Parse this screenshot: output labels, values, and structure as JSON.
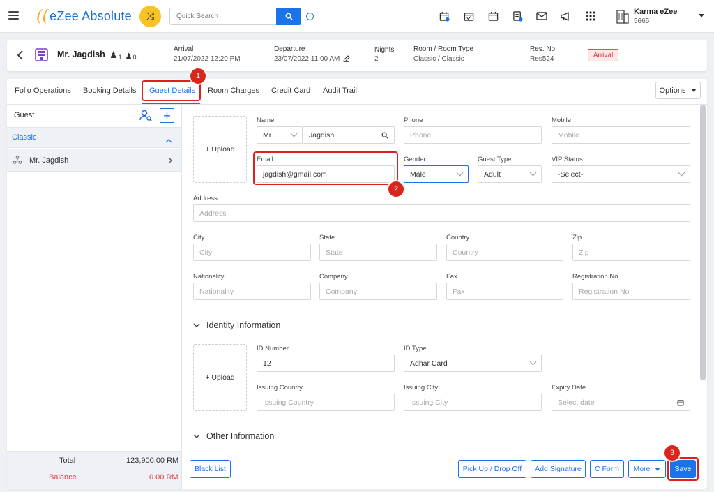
{
  "app": {
    "logo_glyph": "((",
    "brand": "eZee Absolute"
  },
  "search": {
    "placeholder": "Quick Search"
  },
  "user": {
    "name": "Karma eZee",
    "code": "5665"
  },
  "reservation": {
    "guest_name": "Mr. Jagdish",
    "adults": "1",
    "children": "0",
    "arrival_label": "Arrival",
    "arrival_value": "21/07/2022 12:20 PM",
    "departure_label": "Departure",
    "departure_value": "23/07/2022 11:00 AM",
    "nights_label": "Nights",
    "nights_value": "2",
    "room_label": "Room / Room Type",
    "room_value": "Classic / Classic",
    "resno_label": "Res. No.",
    "resno_value": "Res524",
    "status": "Arrival"
  },
  "tabs": [
    "Folio Operations",
    "Booking Details",
    "Guest Details",
    "Room Charges",
    "Credit Card",
    "Audit Trail"
  ],
  "options_label": "Options",
  "left": {
    "guest_label": "Guest",
    "group": "Classic",
    "guest_item": "Mr. Jagdish",
    "total_label": "Total",
    "total_value": "123,900.00 RM",
    "balance_label": "Balance",
    "balance_value": "0.00 RM"
  },
  "form": {
    "upload": "+ Upload",
    "name_label": "Name",
    "salutation": "Mr.",
    "name_value": "Jagdish",
    "phone_label": "Phone",
    "phone_ph": "Phone",
    "mobile_label": "Mobile",
    "mobile_ph": "Mobile",
    "email_label": "Email",
    "email_value": "jagdish@gmail.com",
    "gender_label": "Gender",
    "gender_value": "Male",
    "gtype_label": "Guest Type",
    "gtype_value": "Adult",
    "vip_label": "VIP Status",
    "vip_value": "-Select-",
    "address_label": "Address",
    "address_ph": "Address",
    "city_label": "City",
    "city_ph": "City",
    "state_label": "State",
    "state_ph": "State",
    "country_label": "Country",
    "country_ph": "Country",
    "zip_label": "Zip",
    "zip_ph": "Zip",
    "nationality_label": "Nationality",
    "nationality_ph": "Nationality",
    "company_label": "Company",
    "company_ph": "Company",
    "fax_label": "Fax",
    "fax_ph": "Fax",
    "regno_label": "Registration No",
    "regno_ph": "Registration No"
  },
  "identity": {
    "title": "Identity Information",
    "upload": "+ Upload",
    "idnum_label": "ID Number",
    "idnum_value": "12",
    "idtype_label": "ID Type",
    "idtype_value": "Adhar Card",
    "icountry_label": "Issuing Country",
    "icountry_ph": "Issuing Country",
    "icity_label": "Issuing City",
    "icity_ph": "Issuing City",
    "expiry_label": "Expiry Date",
    "expiry_ph": "Select date"
  },
  "other": {
    "title": "Other Information"
  },
  "buttons": {
    "blacklist": "Black List",
    "pickup": "Pick Up / Drop Off",
    "signature": "Add Signature",
    "cform": "C Form",
    "more": "More",
    "save": "Save"
  },
  "steps": [
    "1",
    "2",
    "3"
  ],
  "colors": {
    "accent": "#1a73e8",
    "highlight": "#e02020",
    "shuffle": "#f7c325"
  }
}
